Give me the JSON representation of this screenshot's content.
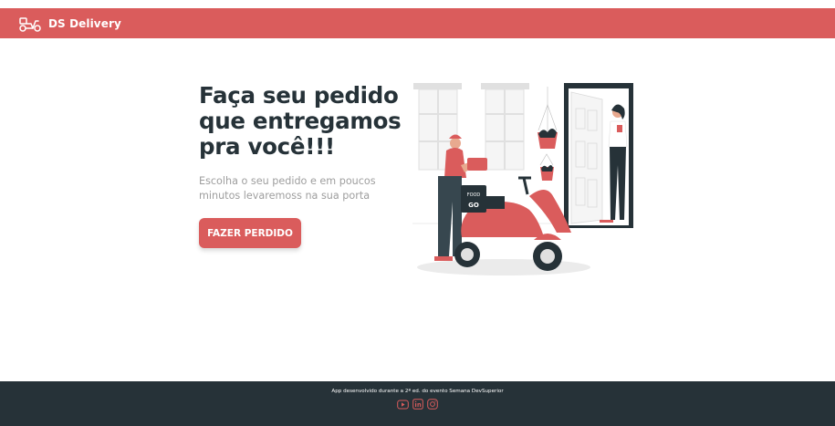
{
  "navbar": {
    "logo_icon": "scooter-icon",
    "title": "DS Delivery"
  },
  "hero": {
    "title_line1": "Faça seu pedido",
    "title_line2": "que entregamos",
    "title_line3": "pra você!!!",
    "subtitle": "Escolha o seu pedido e em poucos minutos levaremoss na sua porta",
    "button_label": "FAZER PERDIDO"
  },
  "illustration": {
    "icon": "delivery-scooter-illustration",
    "box_text_1": "FOOD",
    "box_text_2": "GO"
  },
  "footer": {
    "text": "App desenvolvido durante a 2ª ed. do evento Semana DevSuperior",
    "icons": [
      "youtube-icon",
      "linkedin-icon",
      "instagram-icon"
    ]
  },
  "colors": {
    "primary": "#da5c5c",
    "dark": "#263238",
    "muted_text": "#9e9e9e",
    "background": "#ffffff"
  }
}
